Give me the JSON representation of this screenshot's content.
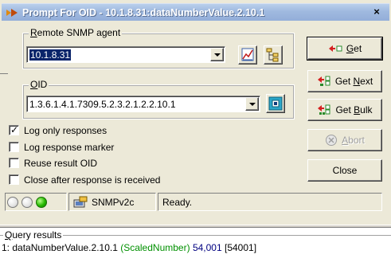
{
  "window": {
    "title": "Prompt For OID - 10.1.8.31:dataNumberValue.2.10.1",
    "close_glyph": "×"
  },
  "agent_group": {
    "legend_ul": "R",
    "legend_rest": "emote SNMP agent",
    "value": "10.1.8.31"
  },
  "oid_group": {
    "legend_ul": "O",
    "legend_rest": "ID",
    "value": "1.3.6.1.4.1.7309.5.2.3.2.1.2.2.10.1"
  },
  "buttons": {
    "get_ul": "G",
    "get_rest": "et",
    "getnext_pre": "Get ",
    "getnext_ul": "N",
    "getnext_rest": "ext",
    "getbulk_pre": "Get ",
    "getbulk_ul": "B",
    "getbulk_rest": "ulk",
    "abort_ul": "A",
    "abort_rest": "bort",
    "close": "Close"
  },
  "options": [
    {
      "label": "Log only responses",
      "checked": true
    },
    {
      "label": "Log response marker",
      "checked": false
    },
    {
      "label": "Reuse result OID",
      "checked": false
    },
    {
      "label": "Close after response is received",
      "checked": false
    }
  ],
  "status": {
    "leds": [
      "off",
      "off",
      "on"
    ],
    "protocol": "SNMPv2c",
    "message": "Ready."
  },
  "results": {
    "header_ul": "Q",
    "header_rest": "uery results",
    "rows": [
      {
        "index": "1: ",
        "name": "dataNumberValue.2.10.1 ",
        "type": "(ScaledNumber)",
        "value": "54,001",
        "raw": "[54001]"
      }
    ]
  },
  "colors": {
    "title_gradient": "#9fb9df",
    "type_text": "#009000",
    "value_text": "#000080",
    "led_on": "#26b800"
  },
  "icons": {
    "title": "snmp-arrow-icon",
    "browse": "graph-icon",
    "tree": "tree-icon",
    "oid_picker": "mib-picker-icon",
    "get": "get-icon",
    "abort": "abort-icon",
    "protocol": "snmp-agent-icon"
  }
}
